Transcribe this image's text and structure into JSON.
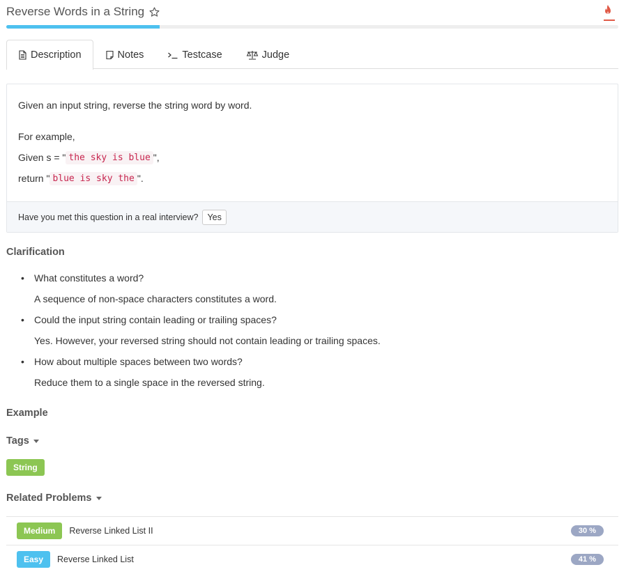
{
  "header": {
    "title": "Reverse Words in a String",
    "progress_fraction": 0.25
  },
  "tabs": [
    {
      "label": "Description",
      "icon": "document-icon",
      "active": true
    },
    {
      "label": "Notes",
      "icon": "note-icon",
      "active": false
    },
    {
      "label": "Testcase",
      "icon": "terminal-icon",
      "active": false
    },
    {
      "label": "Judge",
      "icon": "scale-icon",
      "active": false
    }
  ],
  "description": {
    "intro": "Given an input string, reverse the string word by word.",
    "example_label": "For example,",
    "given_prefix": "Given s = \"",
    "given_code": "the sky is blue",
    "given_suffix": "\",",
    "return_prefix": "return \"",
    "return_code": "blue is sky the",
    "return_suffix": "\".",
    "interview_question": "Have you met this question in a real interview?",
    "interview_yes": "Yes"
  },
  "clarification": {
    "heading": "Clarification",
    "items": [
      {
        "q": "What constitutes a word?",
        "a": "A sequence of non-space characters constitutes a word."
      },
      {
        "q": "Could the input string contain leading or trailing spaces?",
        "a": "Yes. However, your reversed string should not contain leading or trailing spaces."
      },
      {
        "q": "How about multiple spaces between two words?",
        "a": "Reduce them to a single space in the reversed string."
      }
    ]
  },
  "example": {
    "heading": "Example"
  },
  "tags": {
    "heading": "Tags",
    "items": [
      "String"
    ]
  },
  "related": {
    "heading": "Related Problems",
    "items": [
      {
        "difficulty": "Medium",
        "name": "Reverse Linked List II",
        "percent": "30 %"
      },
      {
        "difficulty": "Easy",
        "name": "Reverse Linked List",
        "percent": "41 %"
      }
    ]
  },
  "colors": {
    "accent_blue": "#4ec1ef",
    "tag_green": "#8cc653",
    "code_red": "#c7254e",
    "percent_badge": "#9ca7c4",
    "fire_red": "#e05a47"
  }
}
